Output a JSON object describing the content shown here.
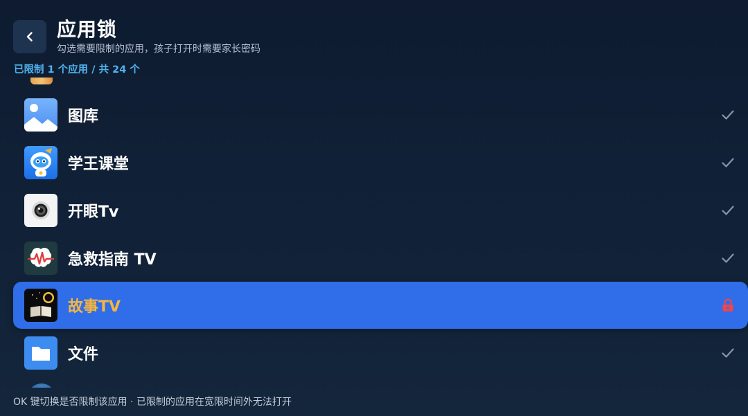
{
  "header": {
    "back_label": "<",
    "title": "应用锁",
    "subtitle": "勾选需要限制的应用，孩子打开时需要家长密码",
    "count_text": "已限制 1 个应用 / 共 24 个"
  },
  "colors": {
    "background": "#112238",
    "focus_highlight": "#2f6de9",
    "focused_text": "#f6b53f",
    "lock_icon": "#f0454c",
    "check_icon": "#8796aa",
    "count_text": "#4fb1ee"
  },
  "apps": [
    {
      "name": "图库",
      "icon": "gallery-icon",
      "state": "unlocked",
      "state_icon": "check-icon",
      "focused": false
    },
    {
      "name": "学王课堂",
      "icon": "xuewang-classroom-icon",
      "state": "unlocked",
      "state_icon": "check-icon",
      "focused": false
    },
    {
      "name": "开眼Tv",
      "icon": "kaiyan-tv-icon",
      "state": "unlocked",
      "state_icon": "check-icon",
      "focused": false
    },
    {
      "name": "急救指南 TV",
      "icon": "first-aid-guide-icon",
      "state": "unlocked",
      "state_icon": "check-icon",
      "focused": false
    },
    {
      "name": "故事TV",
      "icon": "story-tv-icon",
      "state": "locked",
      "state_icon": "lock-icon",
      "focused": true
    },
    {
      "name": "文件",
      "icon": "files-icon",
      "state": "unlocked",
      "state_icon": "check-icon",
      "focused": false
    }
  ],
  "footer": {
    "hint": "OK 键切换是否限制该应用 · 已限制的应用在宽限时间外无法打开"
  }
}
